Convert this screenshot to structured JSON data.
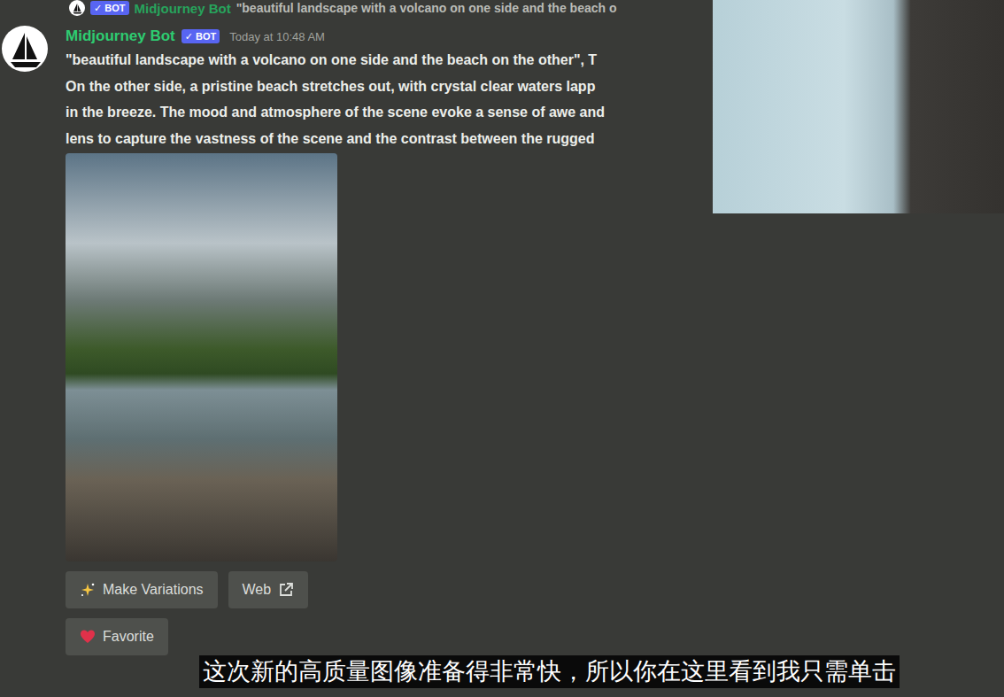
{
  "reply_preview": {
    "badge": "✓ BOT",
    "author": "Midjourney Bot",
    "text": "\"beautiful landscape with a volcano on one side and the beach o"
  },
  "message": {
    "author": "Midjourney Bot",
    "badge": "✓ BOT",
    "time": "Today at 10:48 AM",
    "lines": [
      "\"beautiful landscape with a volcano on one side and the beach on the other\", T",
      "On the other side, a pristine beach stretches out, with crystal clear waters lapp",
      "in the breeze. The mood and atmosphere of the scene evoke a sense of awe and",
      "lens to capture the vastness of the scene and the contrast between the rugged"
    ]
  },
  "buttons": [
    {
      "label": "Make Variations",
      "kind": "sparkle"
    },
    {
      "label": "Web",
      "kind": "link"
    },
    {
      "label": "Favorite",
      "kind": "heart"
    }
  ],
  "subtitle": "这次新的高质量图像准备得非常快，所以你在这里看到我只需单击"
}
